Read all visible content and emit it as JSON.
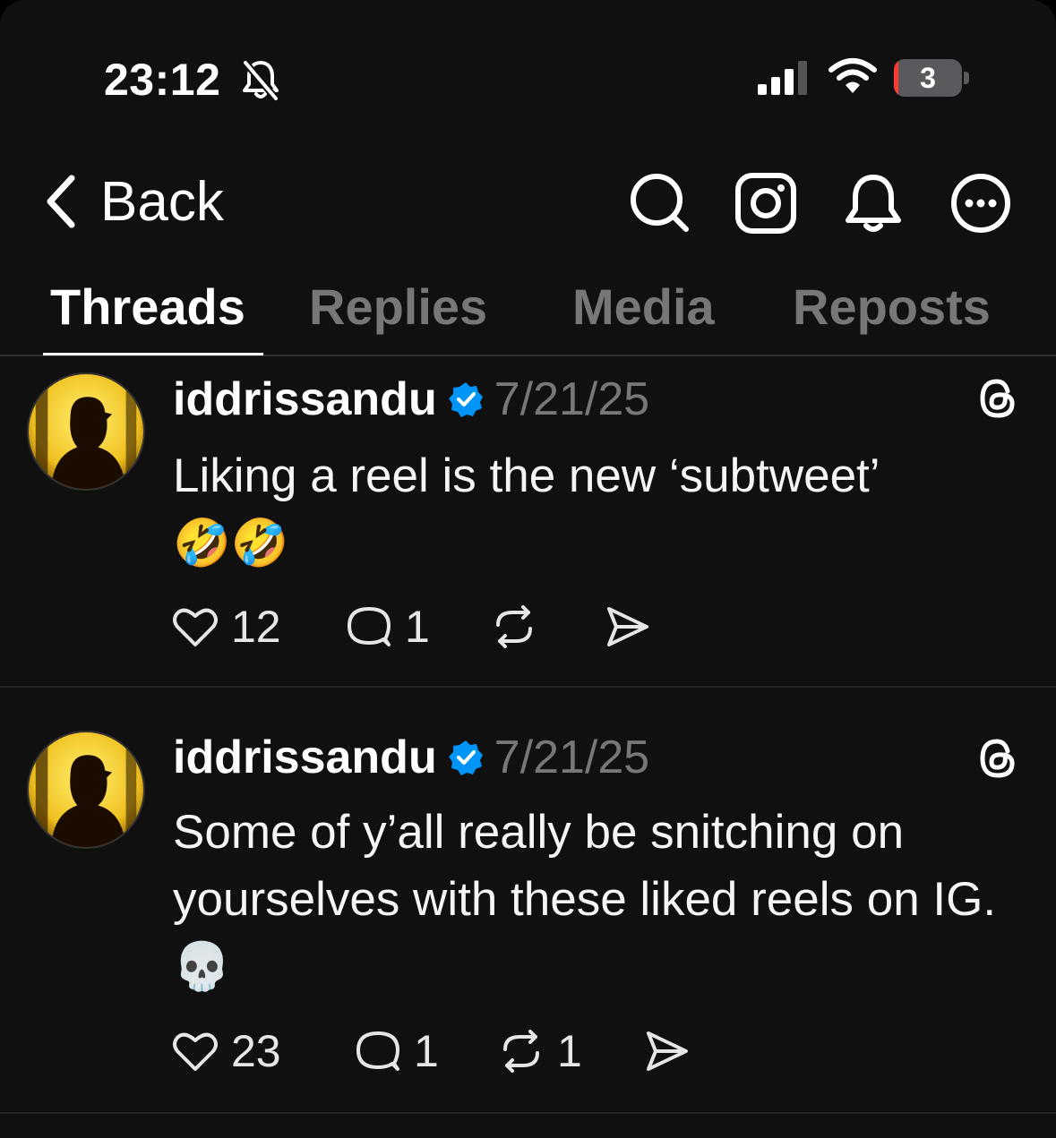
{
  "status_bar": {
    "time": "23:12",
    "battery_level": "3",
    "battery_fraction": 0.03
  },
  "nav": {
    "back_label": "Back",
    "icons": [
      "search-icon",
      "instagram-icon",
      "bell-icon",
      "more-icon"
    ]
  },
  "tabs": [
    {
      "label": "Threads",
      "active": true
    },
    {
      "label": "Replies",
      "active": false
    },
    {
      "label": "Media",
      "active": false
    },
    {
      "label": "Reposts",
      "active": false
    }
  ],
  "posts": [
    {
      "username": "iddrissandu",
      "verified": true,
      "date": "7/21/25",
      "text": "Liking a reel is the new ‘subtweet’",
      "emoji": "🤣🤣",
      "likes": "12",
      "replies": "1",
      "reposts": "",
      "shares": ""
    },
    {
      "username": "iddrissandu",
      "verified": true,
      "date": "7/21/25",
      "text": "Some of y’all really be snitching on yourselves with these liked reels on IG.",
      "emoji": "💀",
      "likes": "23",
      "replies": "1",
      "reposts": "1",
      "shares": ""
    }
  ],
  "colors": {
    "background": "#101010",
    "text_primary": "#f3f5f7",
    "text_secondary": "#777777",
    "verified_blue": "#0095f6",
    "battery_low": "#ff3b30"
  }
}
